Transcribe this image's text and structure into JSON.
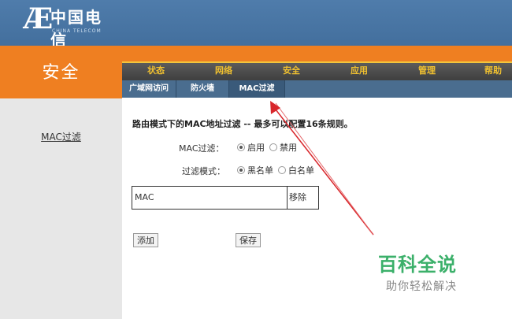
{
  "brand": {
    "logo_cn": "中国电信",
    "logo_en": "CHINA TELECOM",
    "colors": {
      "header": "#4f7cab",
      "accent": "#ef7f21",
      "nav_text": "#f0c030",
      "subnav": "#4a6d8f"
    }
  },
  "section_title": "安全",
  "nav": {
    "items": [
      "状态",
      "网络",
      "安全",
      "应用",
      "管理",
      "帮助"
    ],
    "active": "安全"
  },
  "subnav": {
    "items": [
      "广域网访问",
      "防火墙",
      "MAC过滤"
    ],
    "active": "MAC过滤"
  },
  "sidebar": {
    "link": "MAC过滤"
  },
  "main": {
    "heading": "路由模式下的MAC地址过滤 -- 最多可以配置16条规则。",
    "mac_filter": {
      "label": "MAC过滤：",
      "options": [
        "启用",
        "禁用"
      ],
      "selected": "启用"
    },
    "filter_mode": {
      "label": "过滤模式：",
      "options": [
        "黑名单",
        "白名单"
      ],
      "selected": "黑名单"
    },
    "table": {
      "col_mac": "MAC",
      "col_remove": "移除"
    },
    "add_button": "添加",
    "save_button": "保存"
  },
  "watermark": {
    "title": "百科全说",
    "subtitle": "助你轻松解决"
  }
}
